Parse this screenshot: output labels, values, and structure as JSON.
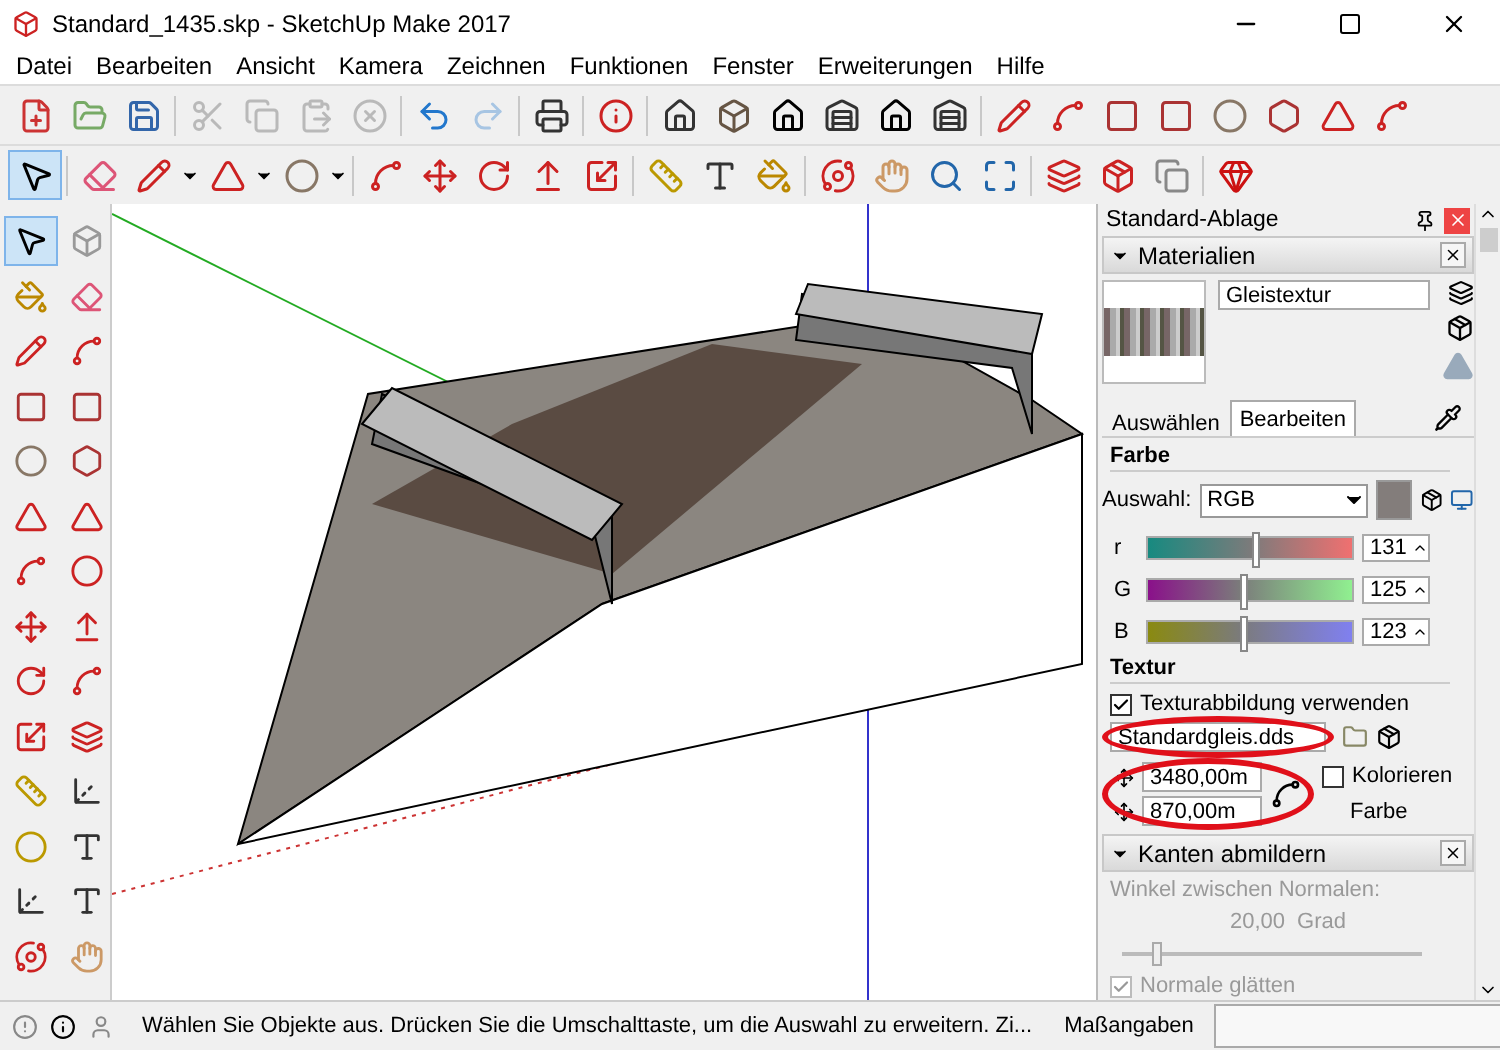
{
  "window": {
    "title": "Standard_1435.skp - SketchUp Make 2017"
  },
  "menu": [
    "Datei",
    "Bearbeiten",
    "Ansicht",
    "Kamera",
    "Zeichnen",
    "Funktionen",
    "Fenster",
    "Erweiterungen",
    "Hilfe"
  ],
  "toolbar_top": [
    {
      "disabled": false
    },
    {
      "disabled": false
    },
    {
      "disabled": false
    },
    {
      "disabled": true
    },
    {
      "disabled": true
    },
    {
      "disabled": true
    },
    {
      "disabled": true
    },
    {
      "disabled": false
    },
    {
      "disabled": true
    },
    {
      "disabled": false
    },
    {
      "disabled": false
    },
    {
      "disabled": false
    },
    {
      "disabled": false
    },
    {
      "disabled": false
    },
    {
      "disabled": false
    },
    {
      "disabled": false
    },
    {
      "disabled": false
    },
    {
      "disabled": false
    },
    {
      "disabled": false
    },
    {
      "disabled": false
    },
    {
      "disabled": false
    },
    {
      "disabled": false
    },
    {
      "disabled": false
    },
    {
      "disabled": false
    },
    {
      "disabled": false
    }
  ],
  "toolbar_tools": [
    {
      "selected": true
    },
    {
      "selected": false
    },
    {
      "selected": false
    },
    {
      "selected": false
    },
    {
      "selected": false
    },
    {
      "selected": false
    },
    {
      "selected": false
    },
    {
      "selected": false
    },
    {
      "selected": false
    },
    {
      "selected": false
    },
    {
      "selected": false
    },
    {
      "selected": false
    },
    {
      "selected": false
    },
    {
      "selected": false
    },
    {
      "selected": false
    },
    {
      "selected": false
    },
    {
      "selected": false
    },
    {
      "selected": false
    },
    {
      "selected": false
    },
    {
      "selected": false
    },
    {
      "selected": false
    }
  ],
  "left_toolbar": [
    {
      "selected": true
    },
    {
      "selected": false
    },
    {
      "selected": false
    },
    {
      "selected": false
    },
    {
      "selected": false
    },
    {
      "selected": false
    },
    {
      "selected": false
    },
    {
      "selected": false
    },
    {
      "selected": false
    },
    {
      "selected": false
    },
    {
      "selected": false
    },
    {
      "selected": false
    },
    {
      "selected": false
    },
    {
      "selected": false
    },
    {
      "selected": false
    },
    {
      "selected": false
    },
    {
      "selected": false
    },
    {
      "selected": false
    },
    {
      "selected": false
    },
    {
      "selected": false
    },
    {
      "selected": false
    },
    {
      "selected": false
    },
    {
      "selected": false
    },
    {
      "selected": false
    },
    {
      "selected": false
    },
    {
      "selected": false
    },
    {
      "selected": false
    },
    {
      "selected": false
    }
  ],
  "tray": {
    "title": "Standard-Ablage",
    "materials": {
      "title": "Materialien",
      "expanded": true,
      "name": "Gleistextur",
      "tabs": [
        {
          "label": "Auswählen",
          "selected": false
        },
        {
          "label": "Bearbeiten",
          "selected": true
        }
      ],
      "color_heading": "Farbe",
      "picker_label": "Auswahl:",
      "picker_value": "RGB",
      "channels": [
        {
          "kind": "red",
          "label": "r",
          "level": 0.51,
          "value": "131"
        },
        {
          "kind": "green",
          "label": "G",
          "level": 0.45,
          "value": "125"
        },
        {
          "kind": "blue",
          "label": "B",
          "level": 0.45,
          "value": "123"
        }
      ],
      "texture_heading": "Textur",
      "use_texture": {
        "label": "Texturabbildung verwenden",
        "checked": true
      },
      "texture_file": "Standardgleis.dds",
      "width": "3480,00m",
      "height": "870,00m",
      "colorize": {
        "label": "Kolorieren",
        "checked": false
      },
      "colorize_sub": "Farbe"
    },
    "soften": {
      "title": "Kanten abmildern",
      "expanded": true,
      "disabled": true,
      "angle_label": "Winkel zwischen Normalen:",
      "angle_value": "20,00",
      "angle_unit": "Grad",
      "level": 0.1,
      "smooth": {
        "label": "Normale glätten",
        "checked": true
      }
    }
  },
  "status_bar": {
    "message": "Wählen Sie Objekte aus. Drücken Sie die Umschalttaste, um die Auswahl zu erweitern. Zi...",
    "measure_label": "Maßangaben"
  }
}
